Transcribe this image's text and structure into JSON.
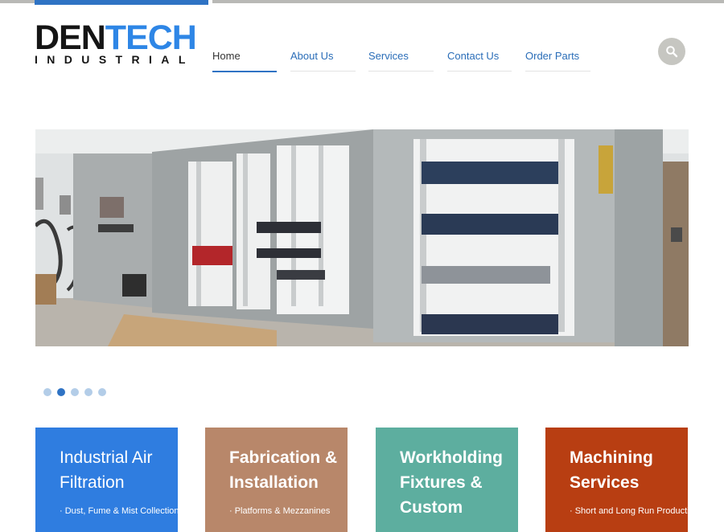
{
  "logo": {
    "line1_dark": "DEN",
    "line1_blue": "TECH",
    "line2": "INDUSTRIAL"
  },
  "nav": {
    "items": [
      {
        "label": "Home"
      },
      {
        "label": "About Us"
      },
      {
        "label": "Services"
      },
      {
        "label": "Contact Us"
      },
      {
        "label": "Order Parts"
      }
    ],
    "active": "Home"
  },
  "search": {
    "icon": "search-icon"
  },
  "hero": {
    "image": "electrical-control-panels",
    "slide_count": 5,
    "active_slide": 2
  },
  "cards": [
    {
      "title": "Industrial Air Filtration",
      "sub": "· Dust, Fume & Mist Collection Systems",
      "color": "#2f7de0"
    },
    {
      "title": "Fabrication & Installation",
      "sub": "· Platforms & Mezzanines",
      "color": "#b8876a"
    },
    {
      "title": "Workholding Fixtures & Custom",
      "sub": "",
      "color": "#5dae9f"
    },
    {
      "title": "Machining Services",
      "sub": "· Short and Long Run Production",
      "color": "#b83e12"
    }
  ],
  "colors": {
    "brand_blue": "#2f73c4",
    "logo_blue": "#2e86e6",
    "nav_link": "#2a6db8"
  }
}
